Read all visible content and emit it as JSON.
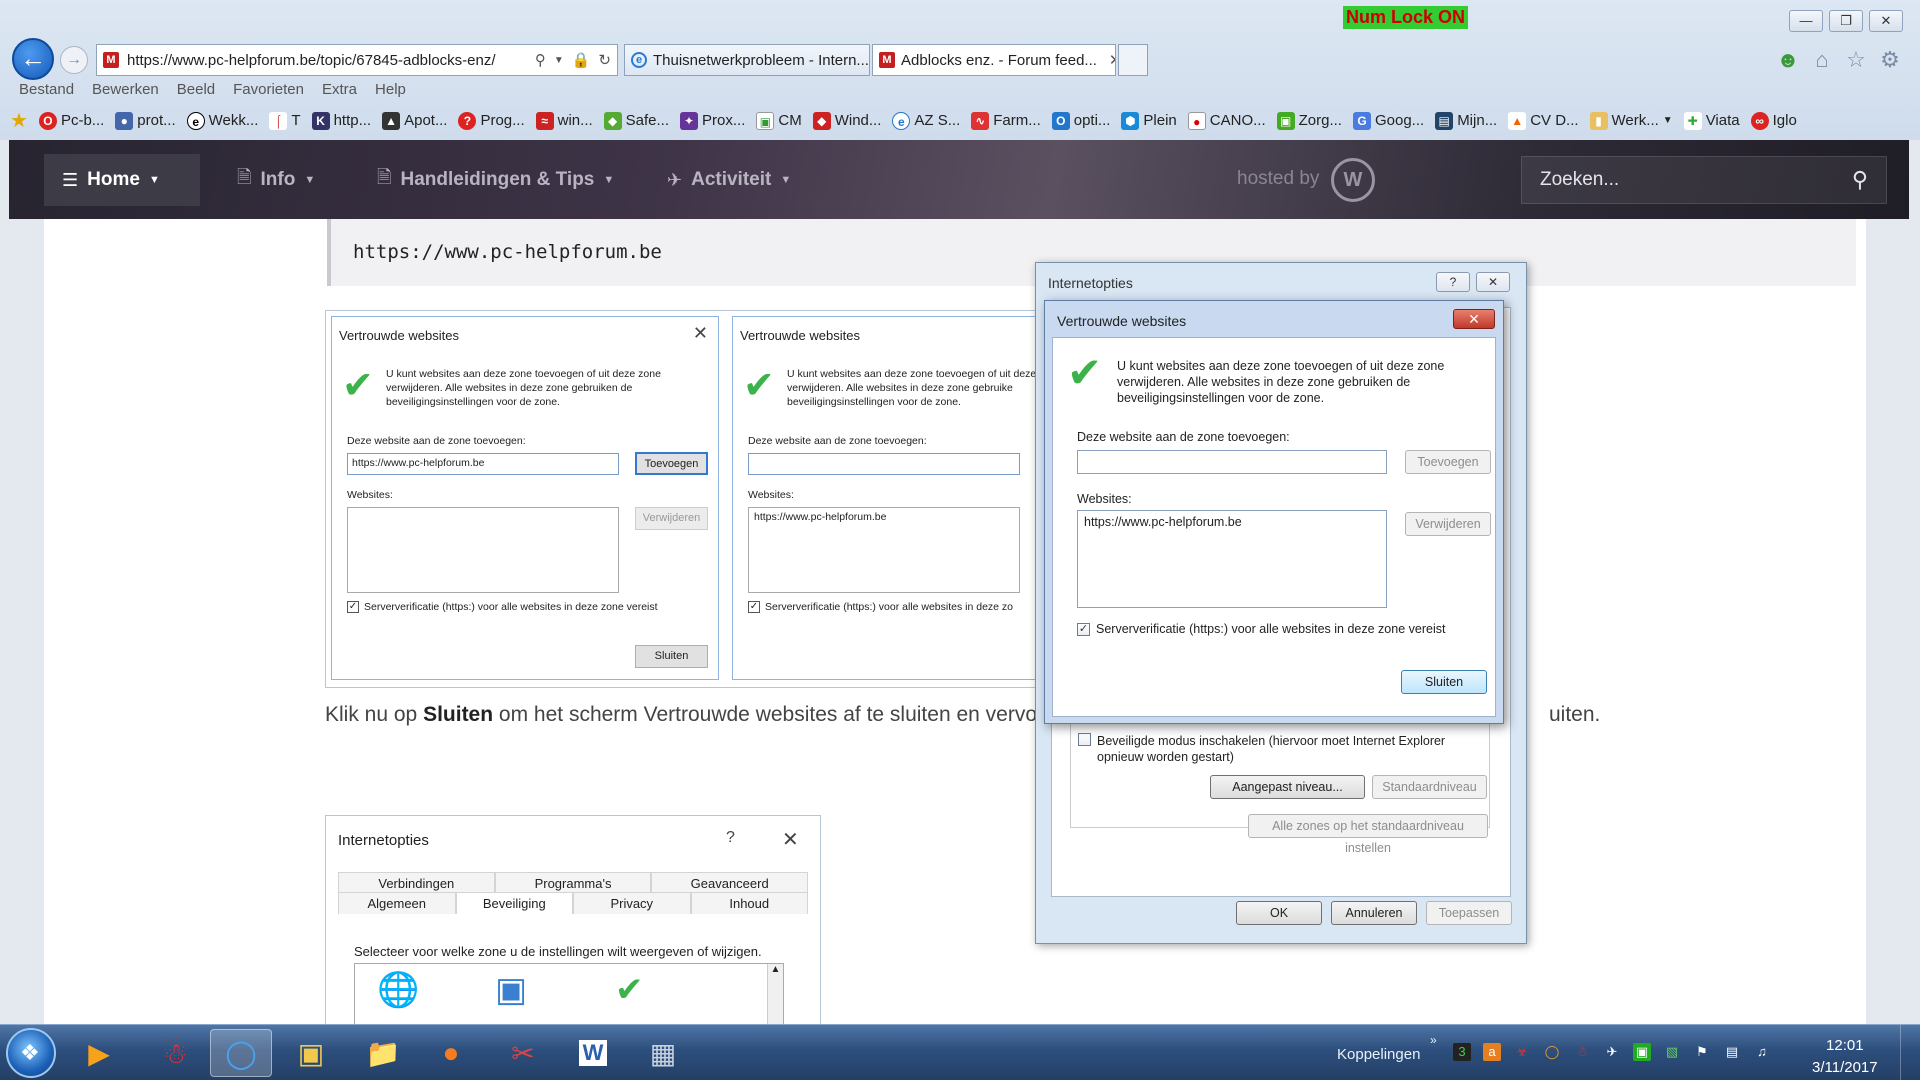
{
  "chrome": {
    "numlock": "Num Lock ON",
    "url": "https://www.pc-helpforum.be/topic/67845-adblocks-enz/",
    "tabs": [
      {
        "label": "Thuisnetwerkprobleem - Intern...",
        "active": false
      },
      {
        "label": "Adblocks enz. - Forum feed...",
        "active": true
      }
    ],
    "menu": [
      "Bestand",
      "Bewerken",
      "Beeld",
      "Favorieten",
      "Extra",
      "Help"
    ],
    "favorites": [
      "Pc-b...",
      "prot...",
      "Wekk...",
      "T",
      "http...",
      "Apot...",
      "Prog...",
      "win...",
      "Safe...",
      "Prox...",
      "CM",
      "Wind...",
      "AZ S...",
      "Farm...",
      "opti...",
      "Plein",
      "CANO...",
      "Zorg...",
      "Goog...",
      "Mijn...",
      "CV D...",
      "Werk...",
      "Viata",
      "Iglo"
    ]
  },
  "site": {
    "nav": [
      "Home",
      "Info",
      "Handleidingen & Tips",
      "Activiteit"
    ],
    "hosted": "hosted by",
    "search_placeholder": "Zoeken...",
    "code": "https://www.pc-helpforum.be",
    "paragraph": {
      "before": "Klik nu op ",
      "bold": "Sluiten",
      "after": " om het scherm Vertrouwde websites af te sluiten en vervol",
      "tail": "uiten."
    }
  },
  "shot1": {
    "left": {
      "title": "Vertrouwde websites",
      "desc": "U kunt websites aan deze zone toevoegen of uit deze zone verwijderen. Alle websites in deze zone gebruiken de beveiligingsinstellingen voor de zone.",
      "add_label": "Deze website aan de zone toevoegen:",
      "input_value": "https://www.pc-helpforum.be",
      "add_button": "Toevoegen",
      "websites_label": "Websites:",
      "remove_button": "Verwijderen",
      "checkbox": "Serververificatie (https:) voor alle websites in deze zone vereist",
      "close_button": "Sluiten"
    },
    "right": {
      "title": "Vertrouwde websites",
      "desc": "U kunt websites aan deze zone toevoegen of uit deze zone verwijderen. Alle websites in deze zone gebruike beveiligingsinstellingen voor de zone.",
      "add_label": "Deze website aan de zone toevoegen:",
      "websites_label": "Websites:",
      "list_item": "https://www.pc-helpforum.be",
      "checkbox": "Serververificatie (https:) voor alle websites in deze zo"
    }
  },
  "shot2": {
    "title": "Internetopties",
    "help": "?",
    "tabs_row1": [
      "Verbindingen",
      "Programma's",
      "Geavanceerd"
    ],
    "tabs_row2": [
      "Algemeen",
      "Beveiliging",
      "Privacy",
      "Inhoud"
    ],
    "hint": "Selecteer voor welke zone u de instellingen wilt weergeven of wijzigen."
  },
  "dlg_io": {
    "title": "Internetopties",
    "help": "?",
    "protected_mode": "Beveiligde modus inschakelen (hiervoor moet Internet Explorer opnieuw worden gestart)",
    "custom_level": "Aangepast niveau...",
    "default_level": "Standaardniveau",
    "reset_all": "Alle zones op het standaardniveau instellen",
    "ok": "OK",
    "cancel": "Annuleren",
    "apply": "Toepassen"
  },
  "dlg_vw": {
    "title": "Vertrouwde websites",
    "desc": "U kunt websites aan deze zone toevoegen of uit deze zone verwijderen. Alle websites in deze zone gebruiken de beveiligingsinstellingen voor de zone.",
    "add_label": "Deze website aan de zone toevoegen:",
    "add_button": "Toevoegen",
    "websites_label": "Websites:",
    "list_item": "https://www.pc-helpforum.be",
    "remove_button": "Verwijderen",
    "checkbox": "Serververificatie (https:) voor alle websites in deze zone vereist",
    "close_button": "Sluiten"
  },
  "taskbar": {
    "links_label": "Koppelingen",
    "time": "12:01",
    "date": "3/11/2017"
  }
}
